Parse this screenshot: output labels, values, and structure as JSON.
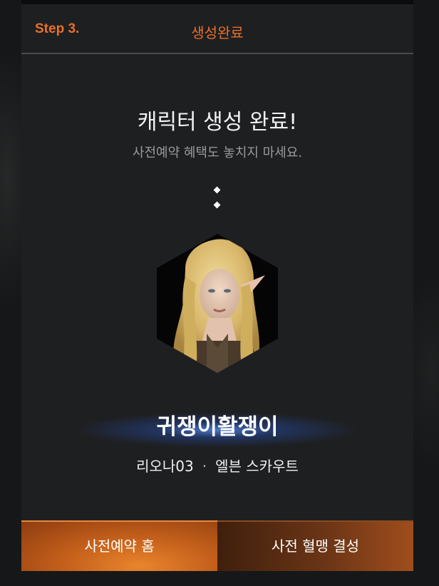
{
  "header": {
    "step": "Step 3.",
    "title": "생성완료"
  },
  "main": {
    "title": "캐릭터 생성 완료!",
    "subtitle": "사전예약 혜택도 놓치지 마세요."
  },
  "character": {
    "name": "귀쟁이활쟁이",
    "server": "리오나03",
    "separator": "·",
    "class": "엘븐 스카우트"
  },
  "buttons": {
    "home": "사전예약 홈",
    "blood_pact": "사전 혈맹 결성"
  },
  "colors": {
    "accent": "#e8702a",
    "panel": "#1e1f21",
    "glow": "#4a8cff"
  }
}
